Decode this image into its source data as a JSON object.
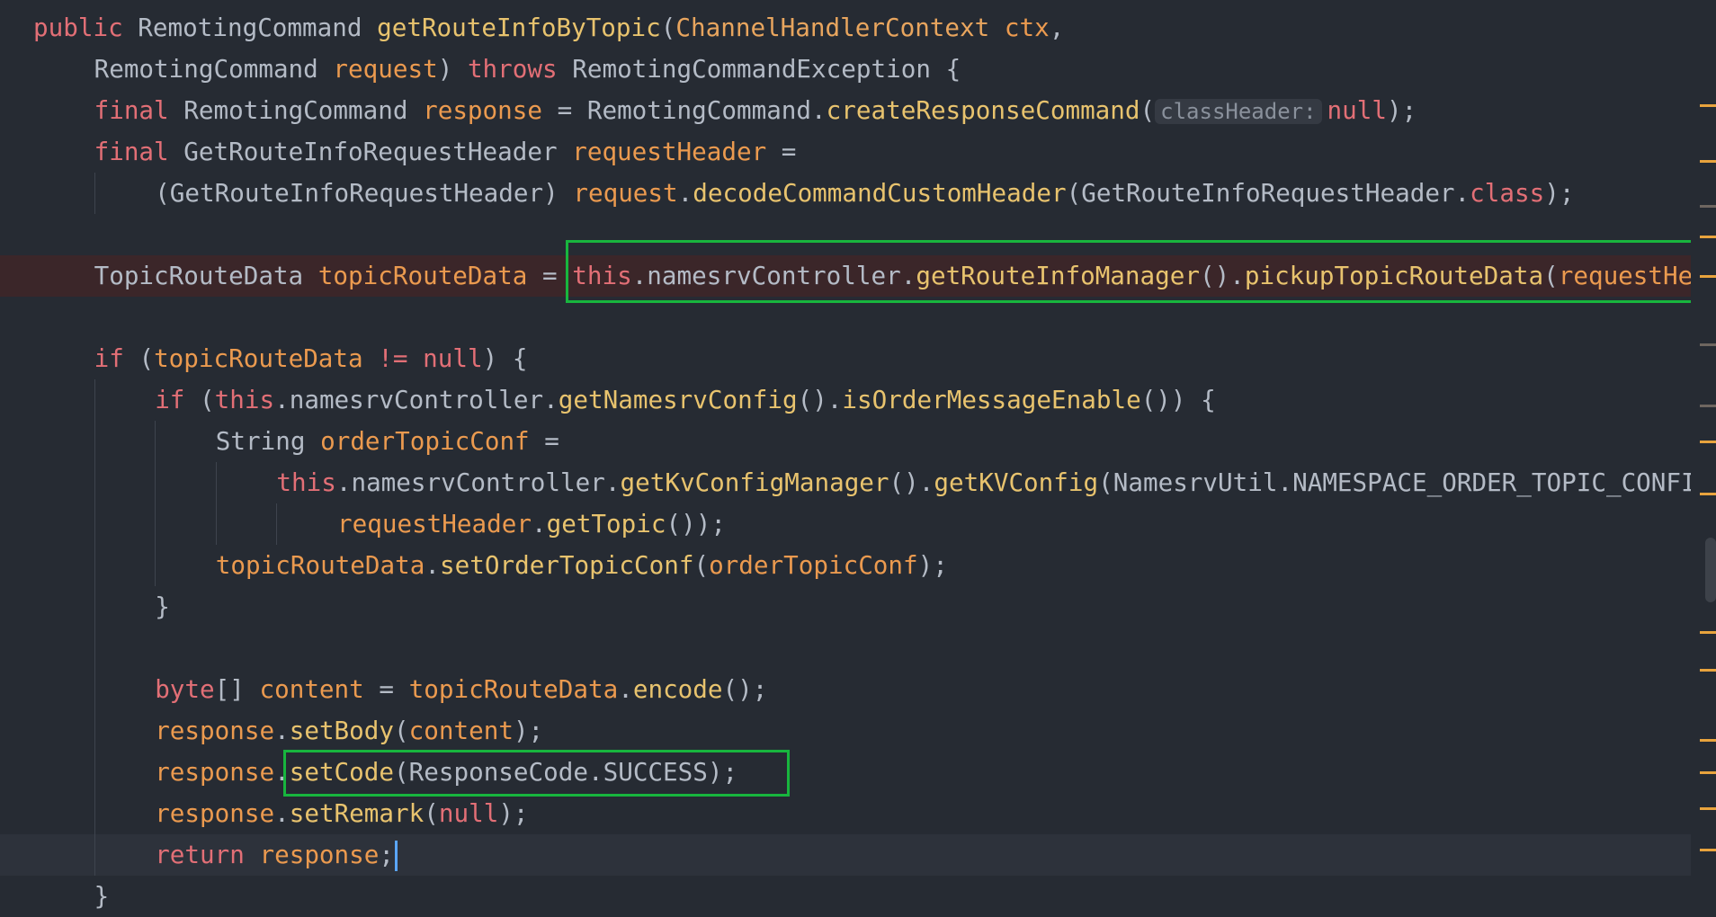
{
  "editor": {
    "lines": [
      {
        "indent": 0,
        "tokens": [
          [
            "kw",
            "public "
          ],
          [
            "type",
            "RemotingCommand "
          ],
          [
            "fn",
            "getRouteInfoByTopic"
          ],
          [
            "plain",
            "("
          ],
          [
            "cls",
            "ChannelHandlerContext"
          ],
          [
            "plain",
            " "
          ],
          [
            "var",
            "ctx"
          ],
          [
            "plain",
            ","
          ]
        ]
      },
      {
        "indent": 1,
        "tokens": [
          [
            "type",
            "RemotingCommand "
          ],
          [
            "var",
            "request"
          ],
          [
            "plain",
            ") "
          ],
          [
            "kw",
            "throws "
          ],
          [
            "type",
            "RemotingCommandException "
          ],
          [
            "plain",
            "{"
          ]
        ]
      },
      {
        "indent": 1,
        "tokens": [
          [
            "kw",
            "final "
          ],
          [
            "type",
            "RemotingCommand "
          ],
          [
            "var",
            "response"
          ],
          [
            "plain",
            " = "
          ],
          [
            "type",
            "RemotingCommand."
          ],
          [
            "fn",
            "createResponseCommand"
          ],
          [
            "plain",
            "("
          ],
          [
            "hint",
            "classHeader:"
          ],
          [
            "kw",
            "null"
          ],
          [
            "plain",
            ");"
          ]
        ]
      },
      {
        "indent": 1,
        "tokens": [
          [
            "kw",
            "final "
          ],
          [
            "type",
            "GetRouteInfoRequestHeader "
          ],
          [
            "var",
            "requestHeader"
          ],
          [
            "plain",
            " ="
          ]
        ]
      },
      {
        "indent": 2,
        "tokens": [
          [
            "plain",
            "(GetRouteInfoRequestHeader) "
          ],
          [
            "var",
            "request"
          ],
          [
            "plain",
            "."
          ],
          [
            "fn",
            "decodeCommandCustomHeader"
          ],
          [
            "plain",
            "(GetRouteInfoRequestHeader."
          ],
          [
            "kw",
            "class"
          ],
          [
            "plain",
            ");"
          ]
        ]
      },
      {
        "indent": 1,
        "tokens": []
      },
      {
        "indent": 1,
        "error": true,
        "tokens": [
          [
            "type",
            "TopicRouteData "
          ],
          [
            "var",
            "topicRouteData"
          ],
          [
            "plain",
            " = "
          ],
          [
            "kw",
            "this"
          ],
          [
            "plain",
            ".namesrvController."
          ],
          [
            "fn",
            "getRouteInfoManager"
          ],
          [
            "plain",
            "()."
          ],
          [
            "fn",
            "pickupTopicRouteData"
          ],
          [
            "plain",
            "("
          ],
          [
            "var",
            "requestHeader"
          ]
        ]
      },
      {
        "indent": 1,
        "tokens": []
      },
      {
        "indent": 1,
        "tokens": [
          [
            "kw",
            "if "
          ],
          [
            "plain",
            "("
          ],
          [
            "var",
            "topicRouteData"
          ],
          [
            "plain",
            " "
          ],
          [
            "kw",
            "!="
          ],
          [
            "plain",
            " "
          ],
          [
            "kw",
            "null"
          ],
          [
            "plain",
            ") {"
          ]
        ]
      },
      {
        "indent": 2,
        "tokens": [
          [
            "kw",
            "if "
          ],
          [
            "plain",
            "("
          ],
          [
            "kw",
            "this"
          ],
          [
            "plain",
            ".namesrvController."
          ],
          [
            "fn",
            "getNamesrvConfig"
          ],
          [
            "plain",
            "()."
          ],
          [
            "fn",
            "isOrderMessageEnable"
          ],
          [
            "plain",
            "()) {"
          ]
        ]
      },
      {
        "indent": 3,
        "tokens": [
          [
            "type",
            "String "
          ],
          [
            "var",
            "orderTopicConf"
          ],
          [
            "plain",
            " ="
          ]
        ]
      },
      {
        "indent": 4,
        "tokens": [
          [
            "kw",
            "this"
          ],
          [
            "plain",
            ".namesrvController."
          ],
          [
            "fn",
            "getKvConfigManager"
          ],
          [
            "plain",
            "()."
          ],
          [
            "fn",
            "getKVConfig"
          ],
          [
            "plain",
            "(NamesrvUtil.NAMESPACE_ORDER_TOPIC_CONFIG,"
          ]
        ]
      },
      {
        "indent": 5,
        "tokens": [
          [
            "var",
            "requestHeader"
          ],
          [
            "plain",
            "."
          ],
          [
            "fn",
            "getTopic"
          ],
          [
            "plain",
            "());"
          ]
        ]
      },
      {
        "indent": 3,
        "tokens": [
          [
            "var",
            "topicRouteData"
          ],
          [
            "plain",
            "."
          ],
          [
            "fn",
            "setOrderTopicConf"
          ],
          [
            "plain",
            "("
          ],
          [
            "var",
            "orderTopicConf"
          ],
          [
            "plain",
            ");"
          ]
        ]
      },
      {
        "indent": 2,
        "tokens": [
          [
            "plain",
            "}"
          ]
        ]
      },
      {
        "indent": 2,
        "tokens": []
      },
      {
        "indent": 2,
        "tokens": [
          [
            "kw",
            "byte"
          ],
          [
            "plain",
            "[] "
          ],
          [
            "var",
            "content"
          ],
          [
            "plain",
            " = "
          ],
          [
            "var",
            "topicRouteData"
          ],
          [
            "plain",
            "."
          ],
          [
            "fn",
            "encode"
          ],
          [
            "plain",
            "();"
          ]
        ]
      },
      {
        "indent": 2,
        "tokens": [
          [
            "var",
            "response"
          ],
          [
            "plain",
            "."
          ],
          [
            "fn",
            "setBody"
          ],
          [
            "plain",
            "("
          ],
          [
            "var",
            "content"
          ],
          [
            "plain",
            ");"
          ]
        ]
      },
      {
        "indent": 2,
        "tokens": [
          [
            "var",
            "response"
          ],
          [
            "plain",
            "."
          ],
          [
            "fn",
            "setCode"
          ],
          [
            "plain",
            "(ResponseCode.SUCCESS);"
          ]
        ]
      },
      {
        "indent": 2,
        "tokens": [
          [
            "var",
            "response"
          ],
          [
            "plain",
            "."
          ],
          [
            "fn",
            "setRemark"
          ],
          [
            "plain",
            "("
          ],
          [
            "kw",
            "null"
          ],
          [
            "plain",
            ");"
          ]
        ]
      },
      {
        "indent": 2,
        "current": true,
        "caret": true,
        "tokens": [
          [
            "kw",
            "return "
          ],
          [
            "var",
            "response"
          ],
          [
            "plain",
            ";"
          ]
        ]
      },
      {
        "indent": 1,
        "tokens": [
          [
            "plain",
            "}"
          ]
        ]
      }
    ]
  },
  "highlights": [
    "call-pickupTopicRouteData",
    "call-setCode"
  ],
  "colors": {
    "background": "#262b33",
    "keyword": "#e26f76",
    "function": "#e8c36e",
    "variable": "#eb9a4f",
    "plain": "#b4bbc6",
    "highlight_box": "#18b53e",
    "error_line": "#3b2629",
    "caret": "#5aa6ff"
  }
}
